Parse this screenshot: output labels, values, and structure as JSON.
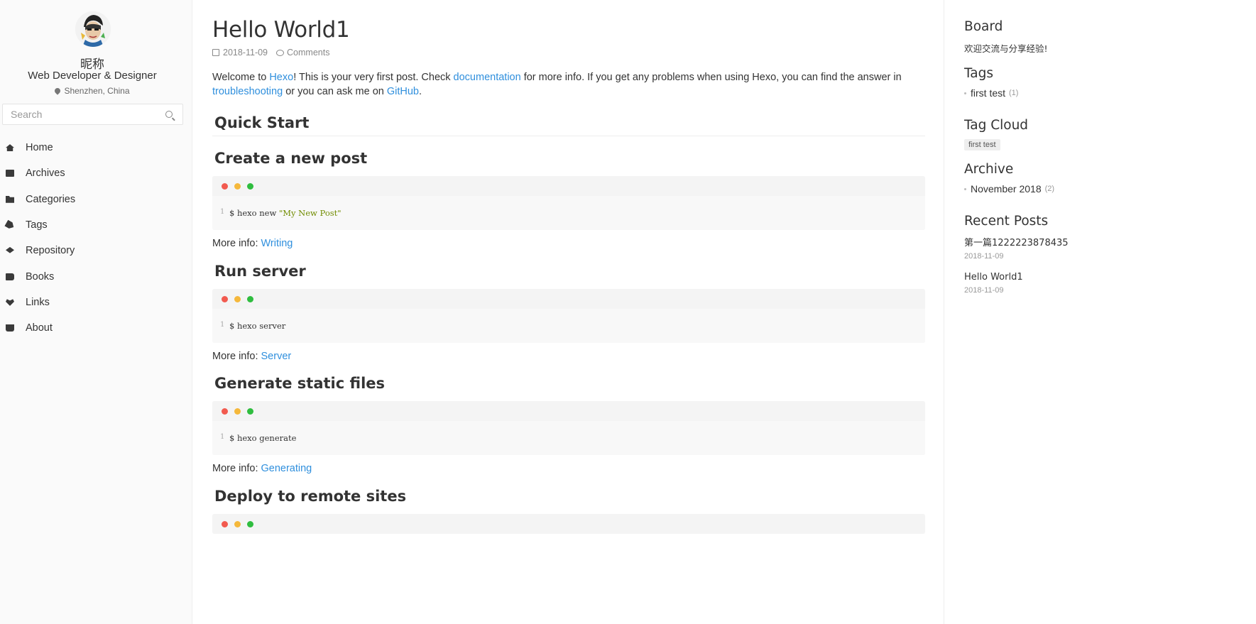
{
  "profile": {
    "nickname": "昵称",
    "role": "Web Developer & Designer",
    "location": "Shenzhen, China"
  },
  "search": {
    "placeholder": "Search"
  },
  "nav": [
    {
      "label": "Home",
      "icon": "home-icon"
    },
    {
      "label": "Archives",
      "icon": "archive-icon"
    },
    {
      "label": "Categories",
      "icon": "folder-icon"
    },
    {
      "label": "Tags",
      "icon": "tag-icon"
    },
    {
      "label": "Repository",
      "icon": "layers-icon"
    },
    {
      "label": "Books",
      "icon": "book-icon"
    },
    {
      "label": "Links",
      "icon": "heart-link-icon"
    },
    {
      "label": "About",
      "icon": "coffee-icon"
    }
  ],
  "post": {
    "title": "Hello World1",
    "date": "2018-11-09",
    "comments_label": "Comments",
    "intro": {
      "t1": "Welcome to ",
      "link1": "Hexo",
      "t2": "! This is your very first post. Check ",
      "link2": "documentation",
      "t3": " for more info. If you get any problems when using Hexo, you can find the answer in ",
      "link3": "troubleshooting",
      "t4": " or you can ask me on ",
      "link4": "GitHub",
      "t5": "."
    },
    "quick_start": "Quick Start",
    "more_info_label": "More info: ",
    "sections": [
      {
        "heading": "Create a new post",
        "line": "1",
        "cmd": "$ hexo new ",
        "str": "\"My New Post\"",
        "more_link": "Writing"
      },
      {
        "heading": "Run server",
        "line": "1",
        "cmd": "$ hexo server",
        "str": "",
        "more_link": "Server"
      },
      {
        "heading": "Generate static files",
        "line": "1",
        "cmd": "$ hexo generate",
        "str": "",
        "more_link": "Generating"
      },
      {
        "heading": "Deploy to remote sites"
      }
    ]
  },
  "right": {
    "board_title": "Board",
    "board_text": "欢迎交流与分享经验!",
    "tags_title": "Tags",
    "tags": [
      {
        "name": "first test",
        "count": "(1)"
      }
    ],
    "tagcloud_title": "Tag Cloud",
    "tagcloud": [
      "first test"
    ],
    "archive_title": "Archive",
    "archive": [
      {
        "name": "November 2018",
        "count": "(2)"
      }
    ],
    "recent_title": "Recent Posts",
    "recent": [
      {
        "title": "第一篇1222223878435",
        "date": "2018-11-09"
      },
      {
        "title": "Hello World1",
        "date": "2018-11-09"
      }
    ]
  },
  "colors": {
    "link": "#2f8fdd",
    "dot_red": "#f25a4f",
    "dot_yellow": "#f5b83b",
    "dot_green": "#2fbd3f"
  }
}
